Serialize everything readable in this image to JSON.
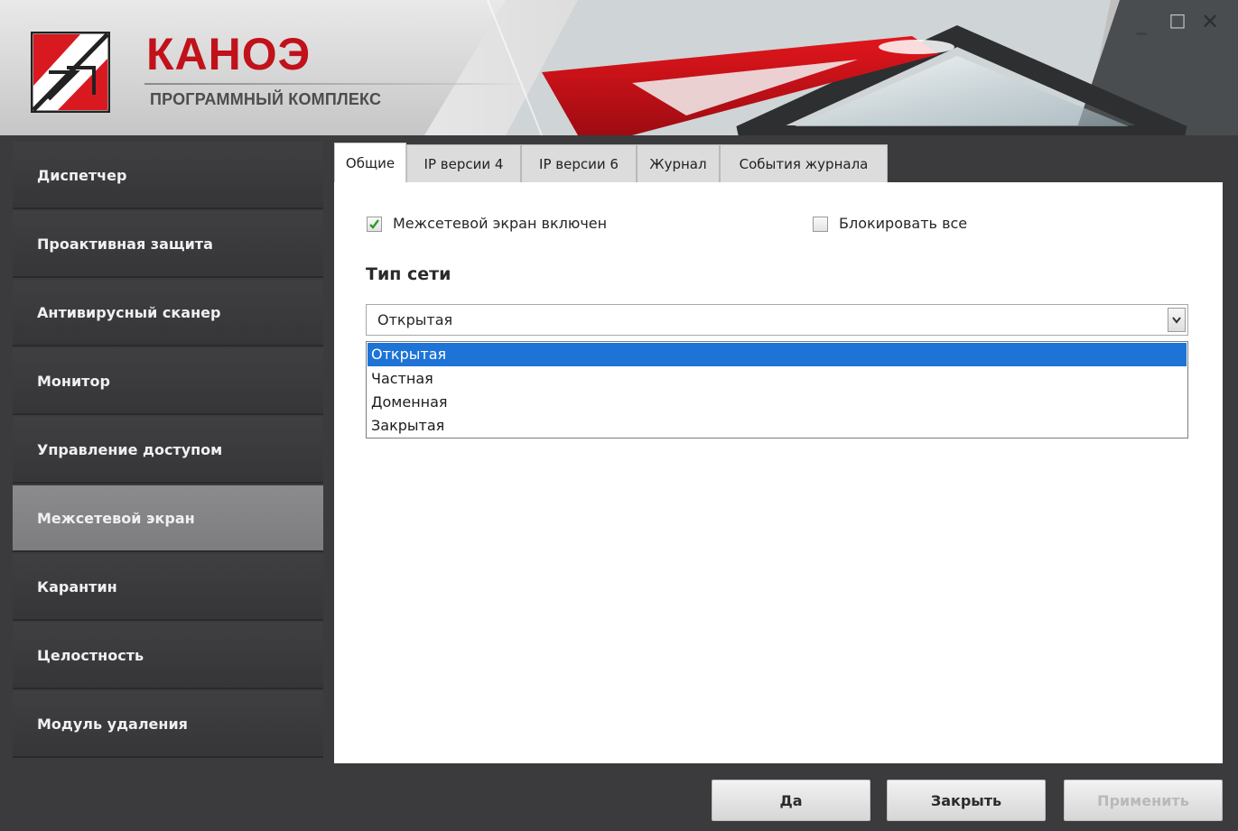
{
  "app": {
    "title": "КАНОЭ",
    "subtitle": "ПРОГРАММНЫЙ КОМПЛЕКС"
  },
  "window_controls": {
    "minimize": "_",
    "maximize": "□",
    "close": "✕"
  },
  "sidebar": {
    "items": [
      {
        "label": "Диспетчер",
        "active": false
      },
      {
        "label": "Проактивная защита",
        "active": false
      },
      {
        "label": "Антивирусный сканер",
        "active": false
      },
      {
        "label": "Монитор",
        "active": false
      },
      {
        "label": "Управление доступом",
        "active": false
      },
      {
        "label": "Межсетевой экран",
        "active": true
      },
      {
        "label": "Карантин",
        "active": false
      },
      {
        "label": "Целостность",
        "active": false
      },
      {
        "label": "Модуль удаления",
        "active": false
      }
    ]
  },
  "tabs": [
    {
      "label": "Общие",
      "active": true
    },
    {
      "label": "IP версии 4",
      "active": false
    },
    {
      "label": "IP версии 6",
      "active": false
    },
    {
      "label": "Журнал",
      "active": false
    },
    {
      "label": "События журнала",
      "active": false
    }
  ],
  "general": {
    "firewall_enabled": {
      "label": "Межсетевой экран включен",
      "checked": true
    },
    "block_all": {
      "label": "Блокировать все",
      "checked": false
    },
    "network_type_title": "Тип сети",
    "network_type": {
      "selected": "Открытая",
      "options": [
        "Открытая",
        "Частная",
        "Доменная",
        "Закрытая"
      ],
      "highlighted": "Открытая"
    }
  },
  "footer": {
    "ok_label": "Да",
    "close_label": "Закрыть",
    "apply_label": "Применить",
    "apply_enabled": false
  },
  "colors": {
    "brand_red": "#c1111a",
    "sidebar_bg": "#3b3b3d",
    "sidebar_active": "#858587",
    "selection_blue": "#1e73d6"
  }
}
